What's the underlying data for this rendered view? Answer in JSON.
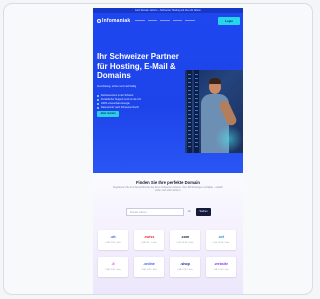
{
  "topbar": {
    "text": "Jetzt Domain sichern – Schweizer Hosting seit über 20 Jahren"
  },
  "nav": {
    "logo": "Infomaniak",
    "button": "Login"
  },
  "hero": {
    "eyebrow": "",
    "headline": "Ihr Schweizer Partner für Hosting, E-Mail & Domains",
    "subline": "Zuverlässig, sicher und nachhaltig",
    "bullets": [
      "Rechenzentren in der Schweiz",
      "Persönlicher Support rund um die Uhr",
      "100% erneuerbare Energie",
      "Datenschutz nach Schweizer Recht"
    ],
    "cta": "Jetzt starten"
  },
  "domains": {
    "title": "Finden Sie Ihre perfekte Domain",
    "text": "Registrieren Sie Ihre Wunschdomain bei Ihrem Schweizer Anbieter. Über 800 Endungen verfügbar – einfach prüfen und sofort sichern.",
    "search_placeholder": "Domain suchen ...",
    "tld_select": ".ch",
    "search_button": "Suchen",
    "tlds": [
      {
        "name": ".ch",
        "price": "CHF 9.90 / Jahr",
        "color": "#1f47f0"
      },
      {
        "name": ".swiss",
        "price": "CHF 89.– / Jahr",
        "color": "#e8323c"
      },
      {
        "name": ".com",
        "price": "CHF 14.90 / Jahr",
        "color": "#151a3d"
      },
      {
        "name": ".net",
        "price": "CHF 16.90 / Jahr",
        "color": "#2a8ae6"
      },
      {
        "name": ".li",
        "price": "CHF 9.90 / Jahr",
        "color": "#c23ad6"
      },
      {
        "name": ".online",
        "price": "CHF 3.90 / Jahr",
        "color": "#3b5bf0"
      },
      {
        "name": ".shop",
        "price": "CHF 5.90 / Jahr",
        "color": "#1b2a8a"
      },
      {
        "name": ".website",
        "price": "CHF 2.90 / Jahr",
        "color": "#8a3cf0"
      }
    ]
  }
}
